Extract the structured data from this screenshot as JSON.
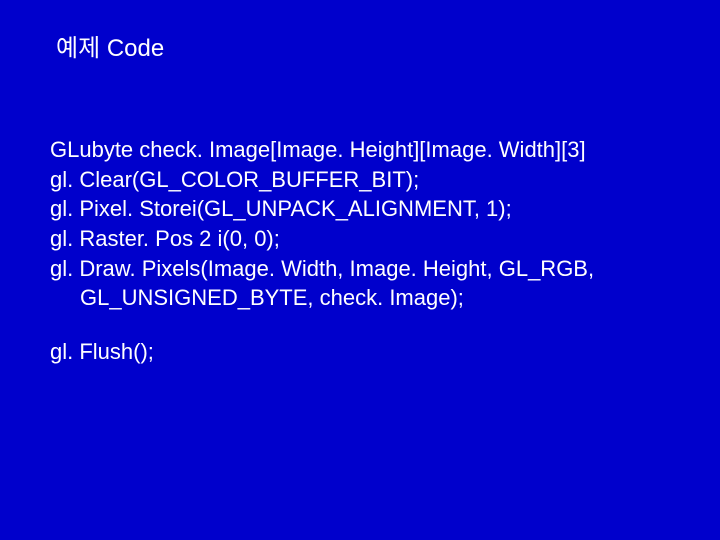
{
  "title": "예제 Code",
  "code": {
    "l1": "GLubyte check. Image[Image. Height][Image. Width][3]",
    "l2": "gl. Clear(GL_COLOR_BUFFER_BIT);",
    "l3": "gl. Pixel. Storei(GL_UNPACK_ALIGNMENT, 1);",
    "l4": "gl. Raster. Pos 2 i(0, 0);",
    "l5": "gl. Draw. Pixels(Image. Width, Image. Height, GL_RGB,",
    "l6": "GL_UNSIGNED_BYTE, check. Image);",
    "l7": "gl. Flush();"
  }
}
